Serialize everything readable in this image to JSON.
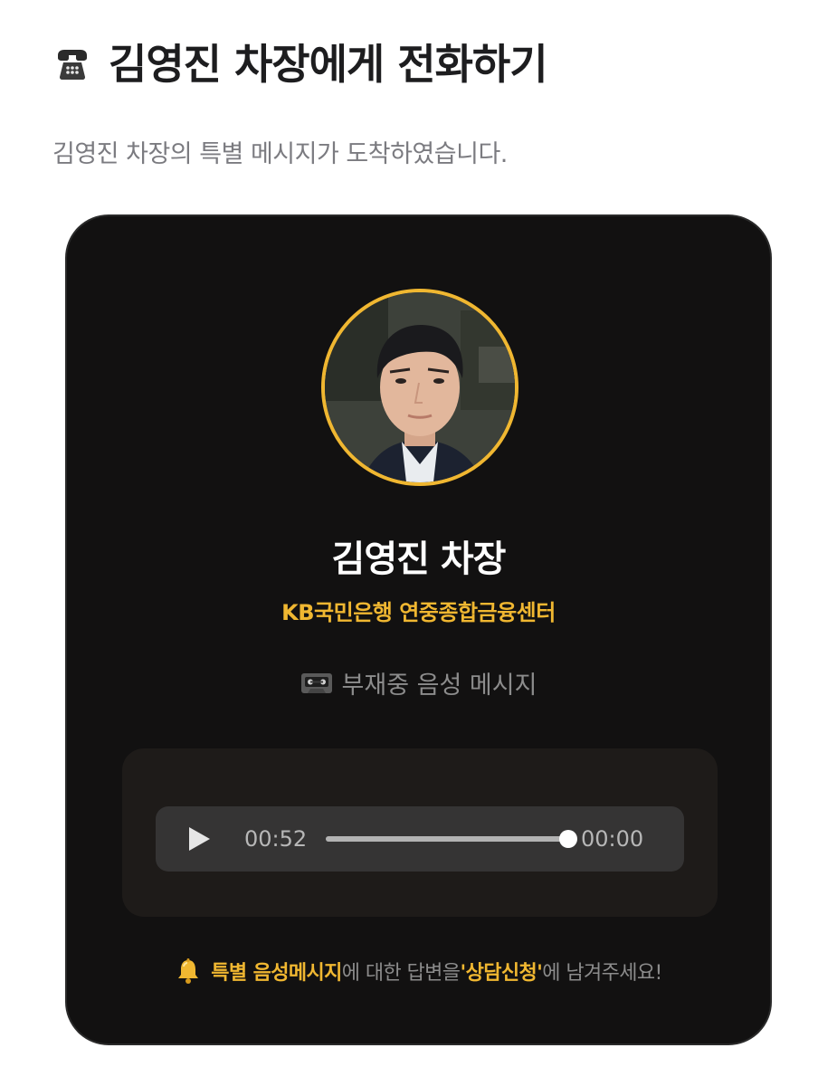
{
  "header": {
    "icon": "phone-icon",
    "title": "김영진 차장에게 전화하기",
    "subtitle": "김영진 차장의 특별 메시지가 도착하였습니다."
  },
  "contact": {
    "avatar": "profile-photo",
    "name": "김영진 차장",
    "organization": "KB국민은행 연중종합금융센터"
  },
  "voicemail": {
    "icon": "cassette-icon",
    "label": "부재중 음성 메시지"
  },
  "player": {
    "play_icon": "play-icon",
    "current_time": "00:52",
    "total_time": "00:00",
    "progress": 1.0
  },
  "footer": {
    "icon": "bell-icon",
    "highlight_1": "특별 음성메시지",
    "text_1": "에 대한 답변을 ",
    "highlight_2": "'상담신청'",
    "text_2": "에 남겨주세요!"
  },
  "colors": {
    "accent": "#f0b731",
    "card_background": "#121111",
    "panel_background": "#1e1b19",
    "player_background": "#353434"
  }
}
